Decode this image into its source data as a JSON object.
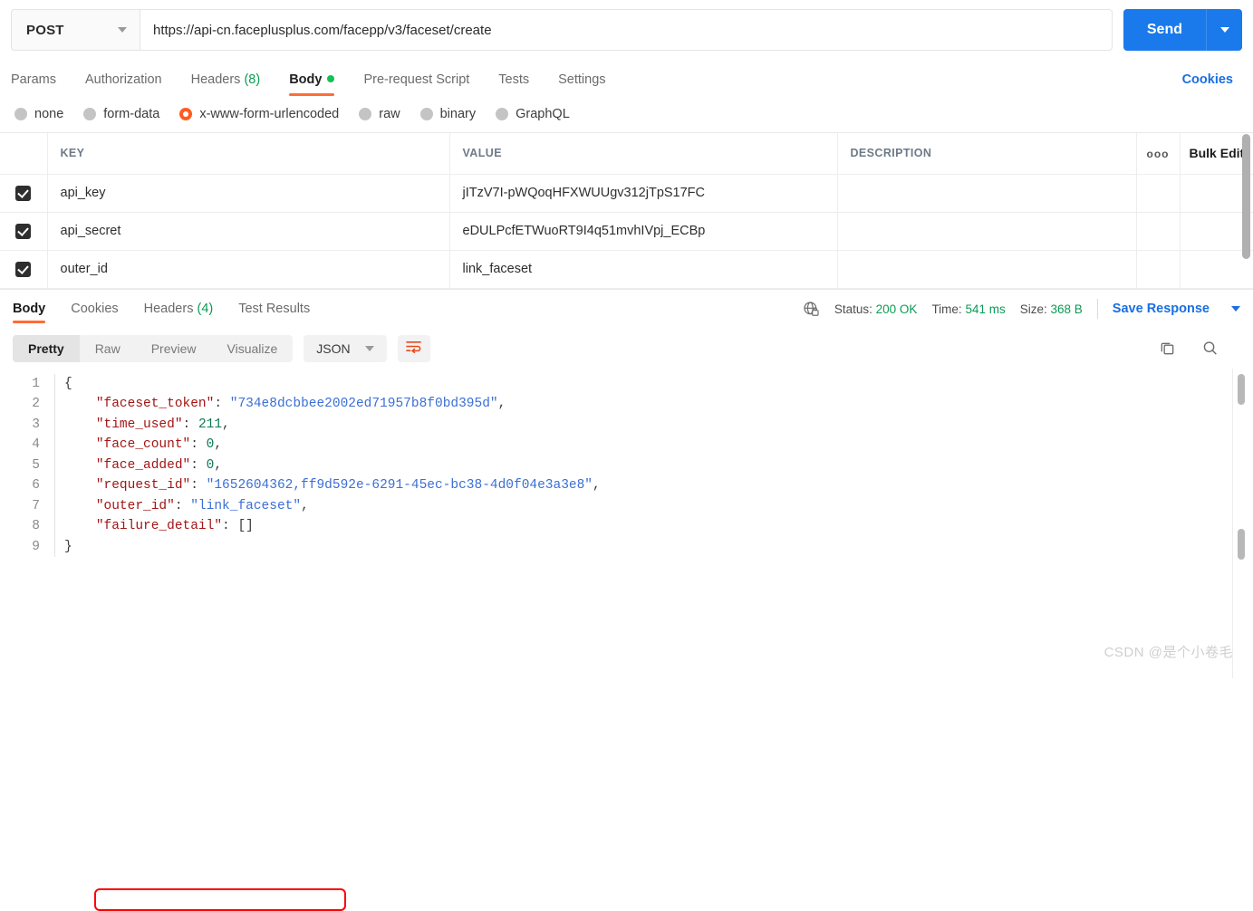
{
  "request": {
    "method": "POST",
    "url": "https://api-cn.faceplusplus.com/facepp/v3/faceset/create",
    "send_label": "Send"
  },
  "request_tabs": [
    {
      "label": "Params",
      "active": false
    },
    {
      "label": "Authorization",
      "active": false
    },
    {
      "label": "Headers",
      "count": "(8)",
      "active": false
    },
    {
      "label": "Body",
      "active": true,
      "dot": true
    },
    {
      "label": "Pre-request Script",
      "active": false
    },
    {
      "label": "Tests",
      "active": false
    },
    {
      "label": "Settings",
      "active": false
    }
  ],
  "cookies_link": "Cookies",
  "body_types": [
    {
      "label": "none",
      "selected": false
    },
    {
      "label": "form-data",
      "selected": false
    },
    {
      "label": "x-www-form-urlencoded",
      "selected": true
    },
    {
      "label": "raw",
      "selected": false
    },
    {
      "label": "binary",
      "selected": false
    },
    {
      "label": "GraphQL",
      "selected": false
    }
  ],
  "param_table": {
    "headers": {
      "key": "KEY",
      "value": "VALUE",
      "description": "DESCRIPTION",
      "options": "ooo",
      "bulk_edit": "Bulk Edit"
    },
    "rows": [
      {
        "checked": true,
        "key": "api_key",
        "value": "jITzV7I-pWQoqHFXWUUgv312jTpS17FC",
        "description": ""
      },
      {
        "checked": true,
        "key": "api_secret",
        "value": "eDULPcfETWuoRT9I4q51mvhIVpj_ECBp",
        "description": ""
      },
      {
        "checked": true,
        "key": "outer_id",
        "value": "link_faceset",
        "description": ""
      }
    ]
  },
  "response_tabs": [
    {
      "label": "Body",
      "active": true
    },
    {
      "label": "Cookies",
      "active": false
    },
    {
      "label": "Headers",
      "count": "(4)",
      "active": false
    },
    {
      "label": "Test Results",
      "active": false
    }
  ],
  "response_meta": {
    "globe_icon": "globe-lock-icon",
    "status_label": "Status:",
    "status_value": "200 OK",
    "time_label": "Time:",
    "time_value": "541 ms",
    "size_label": "Size:",
    "size_value": "368 B",
    "save_response": "Save Response"
  },
  "response_toolbar": {
    "views": [
      {
        "label": "Pretty",
        "active": true
      },
      {
        "label": "Raw",
        "active": false
      },
      {
        "label": "Preview",
        "active": false
      },
      {
        "label": "Visualize",
        "active": false
      }
    ],
    "format": "JSON",
    "wrap_icon": "word-wrap-icon",
    "copy_icon": "copy-icon",
    "search_icon": "search-icon"
  },
  "response_body": {
    "lines": [
      {
        "n": "1",
        "segments": [
          {
            "t": "{",
            "c": "b"
          }
        ]
      },
      {
        "n": "2",
        "segments": [
          {
            "t": "    ",
            "c": "p"
          },
          {
            "t": "\"faceset_token\"",
            "c": "k"
          },
          {
            "t": ": ",
            "c": "p"
          },
          {
            "t": "\"734e8dcbbee2002ed71957b8f0bd395d\"",
            "c": "s"
          },
          {
            "t": ",",
            "c": "p"
          }
        ]
      },
      {
        "n": "3",
        "segments": [
          {
            "t": "    ",
            "c": "p"
          },
          {
            "t": "\"time_used\"",
            "c": "k"
          },
          {
            "t": ": ",
            "c": "p"
          },
          {
            "t": "211",
            "c": "n"
          },
          {
            "t": ",",
            "c": "p"
          }
        ]
      },
      {
        "n": "4",
        "segments": [
          {
            "t": "    ",
            "c": "p"
          },
          {
            "t": "\"face_count\"",
            "c": "k"
          },
          {
            "t": ": ",
            "c": "p"
          },
          {
            "t": "0",
            "c": "n"
          },
          {
            "t": ",",
            "c": "p"
          }
        ]
      },
      {
        "n": "5",
        "segments": [
          {
            "t": "    ",
            "c": "p"
          },
          {
            "t": "\"face_added\"",
            "c": "k"
          },
          {
            "t": ": ",
            "c": "p"
          },
          {
            "t": "0",
            "c": "n"
          },
          {
            "t": ",",
            "c": "p"
          }
        ]
      },
      {
        "n": "6",
        "segments": [
          {
            "t": "    ",
            "c": "p"
          },
          {
            "t": "\"request_id\"",
            "c": "k"
          },
          {
            "t": ": ",
            "c": "p"
          },
          {
            "t": "\"1652604362,ff9d592e-6291-45ec-bc38-4d0f04e3a3e8\"",
            "c": "s"
          },
          {
            "t": ",",
            "c": "p"
          }
        ]
      },
      {
        "n": "7",
        "segments": [
          {
            "t": "    ",
            "c": "p"
          },
          {
            "t": "\"outer_id\"",
            "c": "k"
          },
          {
            "t": ": ",
            "c": "p"
          },
          {
            "t": "\"link_faceset\"",
            "c": "s"
          },
          {
            "t": ",",
            "c": "p"
          }
        ]
      },
      {
        "n": "8",
        "segments": [
          {
            "t": "    ",
            "c": "p"
          },
          {
            "t": "\"failure_detail\"",
            "c": "k"
          },
          {
            "t": ": ",
            "c": "p"
          },
          {
            "t": "[]",
            "c": "b"
          }
        ]
      },
      {
        "n": "9",
        "segments": [
          {
            "t": "}",
            "c": "b"
          }
        ]
      }
    ],
    "highlight_line": "7"
  },
  "watermark": "CSDN @是个小卷毛",
  "colors": {
    "accent_orange": "#ff6c37",
    "send_blue": "#1a7aeb",
    "link_blue": "#1a6fe0",
    "success_green": "#0c9a54",
    "highlight_red": "#ff0000"
  }
}
